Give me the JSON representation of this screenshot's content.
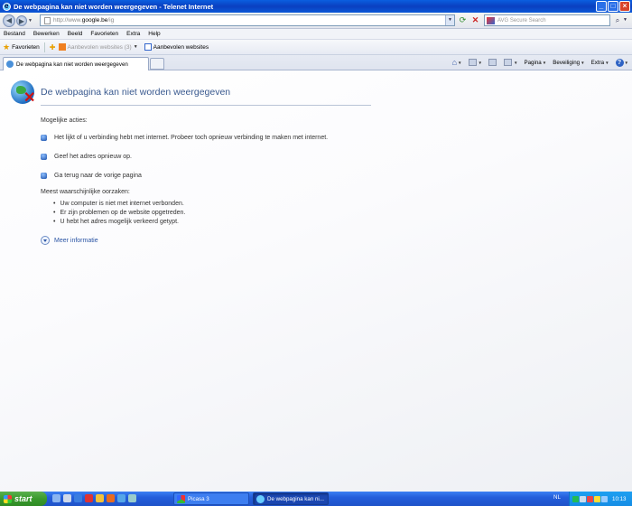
{
  "window": {
    "title": "De webpagina kan niet worden weergegeven - Telenet Internet"
  },
  "address_bar": {
    "url_prefix": "http://www.",
    "url_host": "google.be",
    "url_suffix": "/ig"
  },
  "search_box": {
    "placeholder": "AVG Secure Search"
  },
  "menu": {
    "items": [
      "Bestand",
      "Bewerken",
      "Beeld",
      "Favorieten",
      "Extra",
      "Help"
    ]
  },
  "favorites_bar": {
    "favorites_label": "Favorieten",
    "suggested_sites_label": "Aanbevolen websites (3)",
    "recommended_sites_label": "Aanbevolen websites"
  },
  "tabs": [
    {
      "label": "De webpagina kan niet worden weergegeven"
    }
  ],
  "command_bar": {
    "page_label": "Pagina",
    "security_label": "Beveiliging",
    "tools_label": "Extra"
  },
  "error_page": {
    "heading": "De webpagina kan niet worden weergegeven",
    "actions_title": "Mogelijke acties:",
    "actions": [
      "Het lijkt of u verbinding hebt met internet. Probeer toch opnieuw verbinding te maken met internet.",
      "Geef het adres opnieuw op.",
      "Ga terug naar de vorige pagina"
    ],
    "causes_title": "Meest waarschijnlijke oorzaken:",
    "causes": [
      "Uw computer is niet met internet verbonden.",
      "Er zijn problemen op de website opgetreden.",
      "U hebt het adres mogelijk verkeerd getypt."
    ],
    "more_info_label": "Meer informatie"
  },
  "taskbar": {
    "start_label": "start",
    "windows": [
      {
        "label": "Picasa 3"
      },
      {
        "label": "De webpagina kan ni..."
      }
    ],
    "language": "NL",
    "clock": "10:13"
  }
}
